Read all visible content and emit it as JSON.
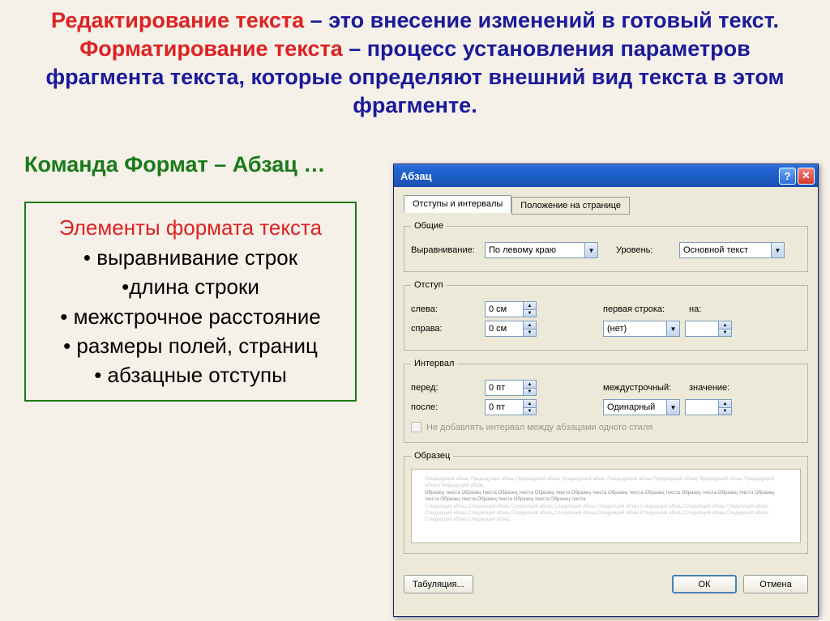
{
  "slide": {
    "p1_red": "Редактирование текста",
    "p1_blue": " – это внесение изменений в готовый текст.",
    "p2_red": "Форматирование текста",
    "p2_blue": " – процесс установления параметров фрагмента текста, которые определяют внешний вид текста в этом фрагменте.",
    "subtitle": "Команда Формат – Абзац …",
    "elements_title": "Элементы формата текста",
    "elements": [
      "• выравнивание строк",
      "•длина строки",
      "• межстрочное расстояние",
      "• размеры полей, страниц",
      "• абзацные отступы"
    ]
  },
  "dialog": {
    "title": "Абзац",
    "tabs": {
      "active": "Отступы и интервалы",
      "other": "Положение на странице"
    },
    "groups": {
      "general": "Общие",
      "indent": "Отступ",
      "spacing": "Интервал",
      "preview": "Образец"
    },
    "general": {
      "align_label": "Выравнивание:",
      "align_value": "По левому краю",
      "level_label": "Уровень:",
      "level_value": "Основной текст"
    },
    "indent": {
      "left_label": "слева:",
      "left_value": "0 см",
      "right_label": "справа:",
      "right_value": "0 см",
      "first_label": "первая строка:",
      "first_value": "(нет)",
      "by_label": "на:",
      "by_value": ""
    },
    "spacing": {
      "before_label": "перед:",
      "before_value": "0 пт",
      "after_label": "после:",
      "after_value": "0 пт",
      "line_label": "междустрочный:",
      "line_value": "Одинарный",
      "at_label": "значение:",
      "at_value": "",
      "checkbox": "Не добавлять интервал между абзацами одного стиля"
    },
    "preview_gray": "Предыдущий абзац Предыдущий абзац Предыдущий абзац Предыдущий абзац Предыдущий абзац Предыдущий абзац Предыдущий абзац Предыдущий абзац Предыдущий абзац",
    "preview_dark": "Образец текста Образец текста Образец текста Образец текста Образец текста Образец текста Образец текста Образец текста Образец текста Образец текста Образец текста Образец текста Образец текста Образец текста",
    "preview_gray2": "Следующий абзац Следующий абзац Следующий абзац Следующий абзац Следующий абзац Следующий абзац Следующий абзац Следующий абзац Следующий абзац Следующий абзац Следующий абзац Следующий абзац Следующий абзац Следующий абзац Следующий абзац Следующий абзац Следующий абзац Следующий абзац",
    "buttons": {
      "tabs": "Табуляция...",
      "ok": "ОК",
      "cancel": "Отмена"
    }
  }
}
